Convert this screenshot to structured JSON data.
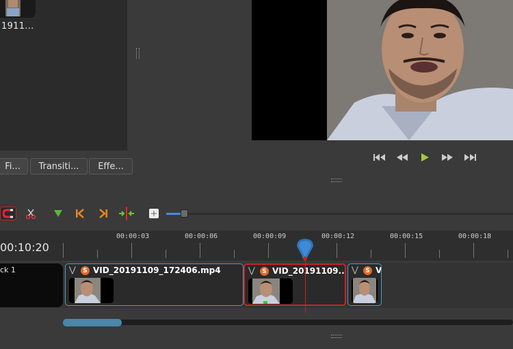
{
  "files": {
    "item_label": "1911..."
  },
  "tabs": [
    {
      "label": "Fi..."
    },
    {
      "label": "Transiti..."
    },
    {
      "label": "Effe..."
    }
  ],
  "transport": {
    "icons": [
      "jump-start-icon",
      "rewind-icon",
      "play-icon",
      "fast-forward-icon",
      "jump-end-icon"
    ]
  },
  "toolbar": {
    "icons": [
      "snap-magnet-icon",
      "razor-icon",
      "add-marker-icon",
      "previous-marker-icon",
      "next-marker-icon",
      "center-playhead-icon",
      "zoom-fit-icon"
    ],
    "zoom_level": 0.05
  },
  "timeline": {
    "current_time": "00:10:20",
    "ruler_labels": [
      "00:00:03",
      "00:00:06",
      "00:00:09",
      "00:00:12",
      "00:00:15",
      "00:00:18"
    ],
    "playhead_color": "#cc1f1f",
    "scroll_position": 0.0
  },
  "track": {
    "name": "ck 1",
    "clips": [
      {
        "title": "VID_20191109_172406.mp4",
        "badge": "S",
        "selected": false
      },
      {
        "title": "VID_20191109...",
        "badge": "S",
        "selected": true
      },
      {
        "title": "V",
        "badge": "S",
        "selected": false
      }
    ]
  },
  "colors": {
    "accent": "#4a8bd6",
    "clip_border": "#4d9bc4",
    "selected_border": "#cc2222",
    "badge": "#e06a2c"
  }
}
